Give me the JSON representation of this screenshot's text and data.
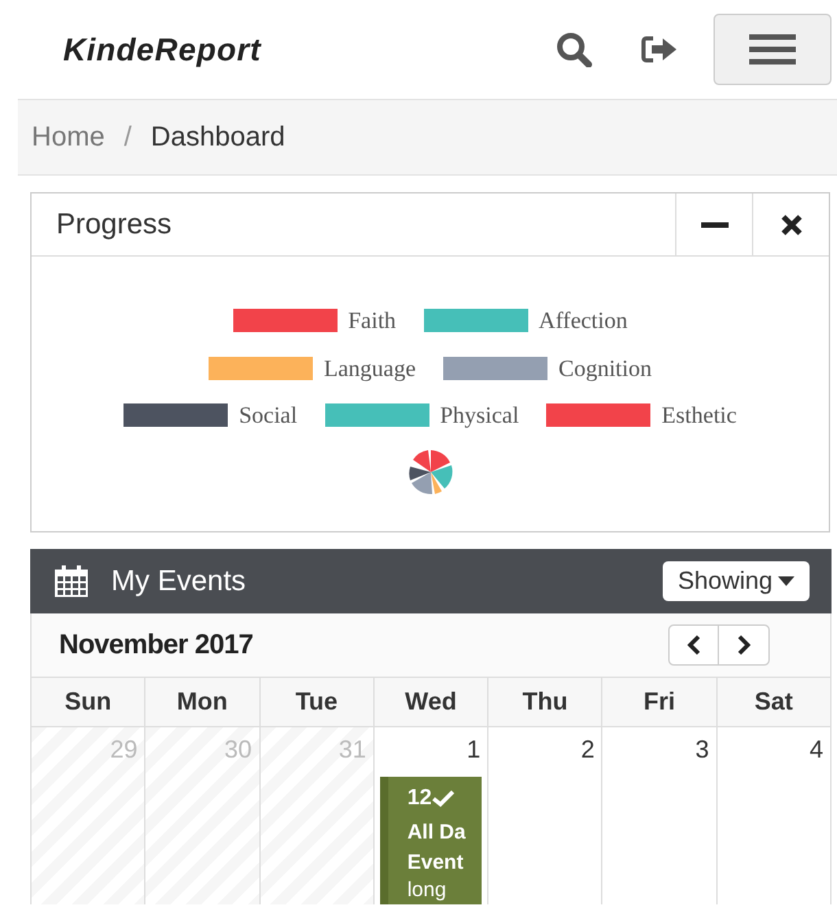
{
  "brand": "KindeReport",
  "breadcrumb_separator": "/",
  "breadcrumb": [
    {
      "label": "Home",
      "selected": false
    },
    {
      "label": "Dashboard",
      "selected": true
    }
  ],
  "progress": {
    "title": "Progress",
    "legend": [
      [
        {
          "label": "Faith",
          "color": "#f2434a"
        },
        {
          "label": "Affection",
          "color": "#46bfb8"
        }
      ],
      [
        {
          "label": "Language",
          "color": "#fcb25a"
        },
        {
          "label": "Cognition",
          "color": "#949fb1"
        }
      ],
      [
        {
          "label": "Social",
          "color": "#4d5360"
        },
        {
          "label": "Physical",
          "color": "#46bfb8"
        },
        {
          "label": "Esthetic",
          "color": "#f2434a"
        }
      ]
    ]
  },
  "events": {
    "title": "My Events",
    "filter": "Showing",
    "month": "November 2017",
    "weekdays": [
      "Sun",
      "Mon",
      "Tue",
      "Wed",
      "Thu",
      "Fri",
      "Sat"
    ],
    "days": [
      {
        "label": "29",
        "other_month": true
      },
      {
        "label": "30",
        "other_month": true
      },
      {
        "label": "31",
        "other_month": true
      },
      {
        "label": "1",
        "other_month": false,
        "event": {
          "time": "12",
          "title": "All Da",
          "line2": "Event",
          "line3": "long"
        }
      },
      {
        "label": "2",
        "other_month": false
      },
      {
        "label": "3",
        "other_month": false
      },
      {
        "label": "4",
        "other_month": false
      }
    ]
  }
}
